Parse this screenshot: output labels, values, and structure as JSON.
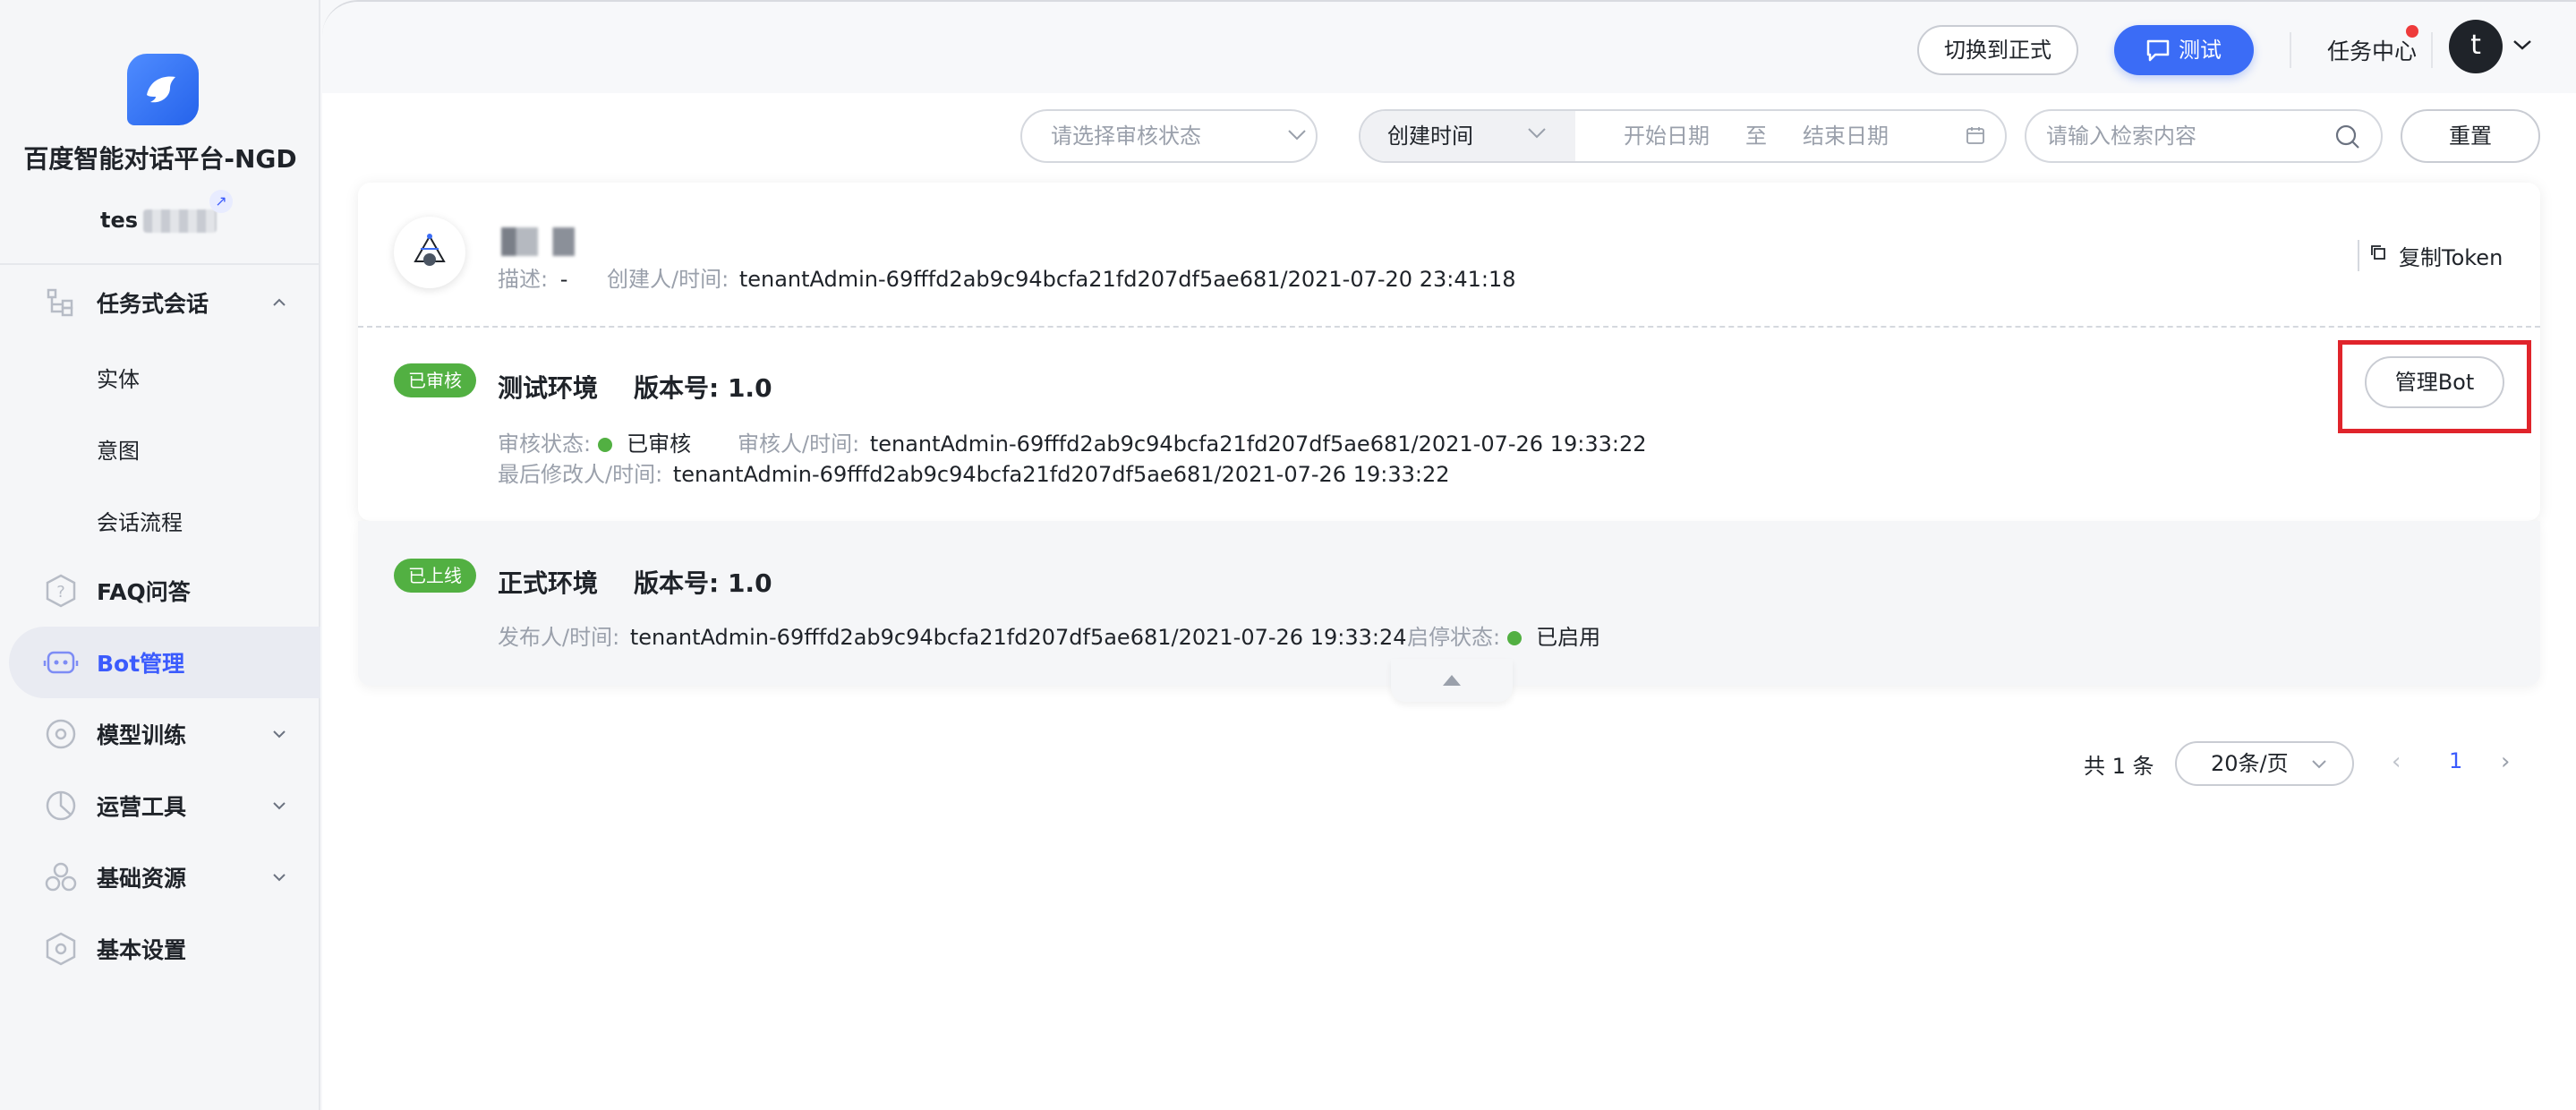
{
  "sidebar": {
    "brand": "百度智能对话平台-NGD",
    "tenant": "tes",
    "items": [
      {
        "label": "任务式会话",
        "icon": "tree-icon"
      },
      {
        "label": "FAQ问答",
        "icon": "question-hex-icon"
      },
      {
        "label": "Bot管理",
        "icon": "robot-icon"
      },
      {
        "label": "模型训练",
        "icon": "model-icon"
      },
      {
        "label": "运营工具",
        "icon": "chart-pie-icon"
      },
      {
        "label": "基础资源",
        "icon": "cubes-icon"
      },
      {
        "label": "基本设置",
        "icon": "settings-hex-icon"
      }
    ],
    "sub_items": [
      "实体",
      "意图",
      "会话流程"
    ],
    "active": "Bot管理"
  },
  "topbar": {
    "switch_label": "切换到正式",
    "test_label": "测试",
    "task_center": "任务中心",
    "avatar_letter": "t"
  },
  "filters": {
    "status_placeholder": "请选择审核状态",
    "date_type": "创建时间",
    "start_date": "开始日期",
    "to": "至",
    "end_date": "结束日期",
    "search_placeholder": "请输入检索内容",
    "reset_label": "重置"
  },
  "bot": {
    "desc_label": "描述:",
    "desc_value": "-",
    "creator_label": "创建人/时间:",
    "creator_value": "tenantAdmin-69fffd2ab9c94bcfa21fd207df5ae681/2021-07-20 23:41:18",
    "copy_token": "复制Token",
    "test_env": {
      "badge": "已审核",
      "title": "测试环境",
      "version": "版本号: 1.0",
      "review_status_label": "审核状态:",
      "review_status_value": "已审核",
      "reviewer_label": "审核人/时间:",
      "reviewer_value": "tenantAdmin-69fffd2ab9c94bcfa21fd207df5ae681/2021-07-26 19:33:22",
      "modifier_label": "最后修改人/时间:",
      "modifier_value": "tenantAdmin-69fffd2ab9c94bcfa21fd207df5ae681/2021-07-26 19:33:22",
      "manage_label": "管理Bot"
    },
    "prod_env": {
      "badge": "已上线",
      "title": "正式环境",
      "version": "版本号: 1.0",
      "publisher_label": "发布人/时间:",
      "publisher_value": "tenantAdmin-69fffd2ab9c94bcfa21fd207df5ae681/2021-07-26 19:33:24",
      "state_label": "启停状态:",
      "state_value": "已启用"
    }
  },
  "pagination": {
    "total": "共 1 条",
    "page_size": "20条/页",
    "current": "1"
  },
  "colors": {
    "accent": "#3b6cf6",
    "success": "#52b042",
    "highlight": "#e0242b"
  }
}
